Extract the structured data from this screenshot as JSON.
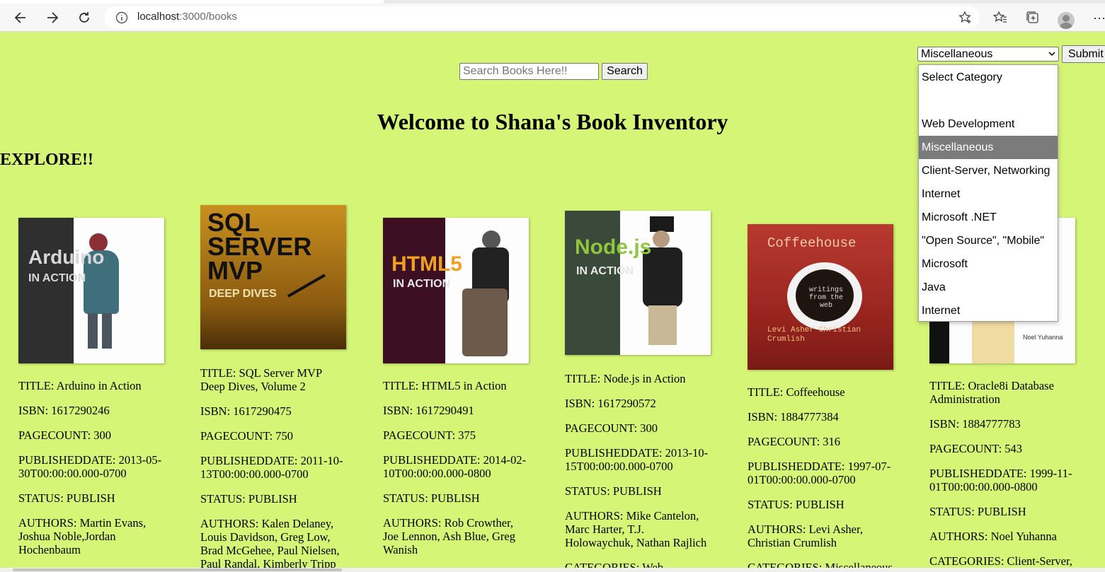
{
  "browser": {
    "url_host": "localhost",
    "url_path": ":3000/books"
  },
  "search": {
    "placeholder": "Search Books Here!!",
    "button_label": "Search"
  },
  "category": {
    "selected": "Miscellaneous",
    "submit_label": "Submit",
    "options": [
      "Select Category",
      "",
      "Web Development",
      "Miscellaneous",
      "Client-Server, Networking",
      "Internet",
      "Microsoft .NET",
      "\"Open Source\", \"Mobile\"",
      "Microsoft",
      "Java",
      "Internet"
    ]
  },
  "page": {
    "title": "Welcome to Shana's Book Inventory",
    "explore": "EXPLORE!!"
  },
  "books": [
    {
      "cover_title": "Arduino",
      "cover_sub": "IN ACTION",
      "title": "TITLE: Arduino in Action",
      "isbn": "ISBN: 1617290246",
      "pagecount": "PAGECOUNT: 300",
      "published": "PUBLISHEDDATE: 2013-05-30T00:00:00.000-0700",
      "status": "STATUS: PUBLISH",
      "authors": "AUTHORS: Martin Evans, Joshua Noble,Jordan Hochenbaum",
      "categories": ""
    },
    {
      "cover_title": "SQL SERVER MVP",
      "cover_sub": "DEEP DIVES",
      "title": "TITLE: SQL Server MVP Deep Dives, Volume 2",
      "isbn": "ISBN: 1617290475",
      "pagecount": "PAGECOUNT: 750",
      "published": "PUBLISHEDDATE: 2011-10-13T00:00:00.000-0700",
      "status": "STATUS: PUBLISH",
      "authors": "AUTHORS: Kalen Delaney, Louis Davidson, Greg Low, Brad McGehee, Paul Nielsen, Paul Randal, Kimberly Tripp",
      "categories": ""
    },
    {
      "cover_title": "HTML5",
      "cover_sub": "IN ACTION",
      "title": "TITLE: HTML5 in Action",
      "isbn": "ISBN: 1617290491",
      "pagecount": "PAGECOUNT: 375",
      "published": "PUBLISHEDDATE: 2014-02-10T00:00:00.000-0800",
      "status": "STATUS: PUBLISH",
      "authors": "AUTHORS: Rob Crowther, Joe Lennon, Ash Blue, Greg Wanish",
      "categories": ""
    },
    {
      "cover_title": "Node.js",
      "cover_sub": "IN ACTION",
      "title": "TITLE: Node.js in Action",
      "isbn": "ISBN: 1617290572",
      "pagecount": "PAGECOUNT: 300",
      "published": "PUBLISHEDDATE: 2013-10-15T00:00:00.000-0700",
      "status": "STATUS: PUBLISH",
      "authors": "AUTHORS: Mike Cantelon, Marc Harter, T.J. Holowaychuk, Nathan Rajlich",
      "categories": "CATEGORIES: Web"
    },
    {
      "cover_title": "Coffeehouse",
      "cover_sub": "writings from the web",
      "cover_authors": "Levi Asher Christian Crumlish",
      "title": "TITLE: Coffeehouse",
      "isbn": "ISBN: 1884777384",
      "pagecount": "PAGECOUNT: 316",
      "published": "PUBLISHEDDATE: 1997-07-01T00:00:00.000-0700",
      "status": "STATUS: PUBLISH",
      "authors": "AUTHORS: Levi Asher, Christian Crumlish",
      "categories": "CATEGORIES: Miscellaneous"
    },
    {
      "cover_title": "",
      "cover_sub": "",
      "cover_authors": "Noel Yuhanna",
      "title": "TITLE: Oracle8i Database Administration",
      "isbn": "ISBN: 1884777783",
      "pagecount": "PAGECOUNT: 543",
      "published": "PUBLISHEDDATE: 1999-11-01T00:00:00.000-0800",
      "status": "STATUS: PUBLISH",
      "authors": "AUTHORS: Noel Yuhanna",
      "categories": "CATEGORIES: Client-Server,"
    }
  ],
  "colors": {
    "page_background": "#d4f576",
    "selected_option": "#7b7b7b"
  }
}
